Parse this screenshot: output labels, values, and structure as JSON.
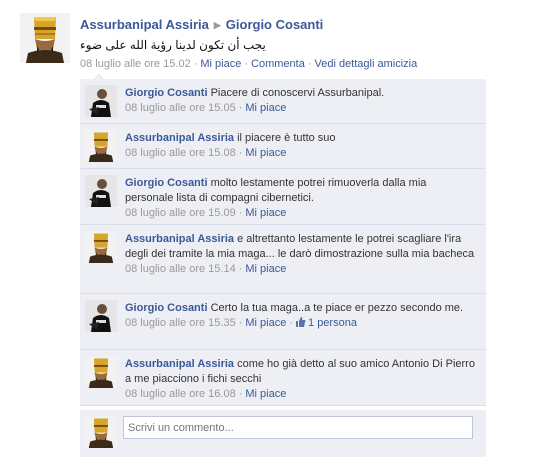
{
  "post": {
    "author": "Assurbanipal Assiria",
    "target": "Giorgio Cosanti",
    "text": "يجب أن تكون لدينا رؤية الله على ضوء",
    "time": "08 luglio alle ore 15.02",
    "like_label": "Mi piace",
    "comment_label": "Commenta",
    "friendship_label": "Vedi dettagli amicizia"
  },
  "like_label": "Mi piace",
  "comments": [
    {
      "author": "Giorgio Cosanti",
      "text": "Piacere di conoscervi Assurbanipal.",
      "time": "08 luglio alle ore 15.05"
    },
    {
      "author": "Assurbanipal Assiria",
      "text": "il piacere è tutto suo",
      "time": "08 luglio alle ore 15.08"
    },
    {
      "author": "Giorgio Cosanti",
      "text": "molto lestamente potrei rimuoverla dalla mia personale lista di compagni cibernetici.",
      "time": "08 luglio alle ore 15.09"
    },
    {
      "author": "Assurbanipal Assiria",
      "text": "e altrettanto lestamente le potrei scagliare l'ira degli dei tramite la mia maga... le darò dimostrazione sulla mia bacheca",
      "time": "08 luglio alle ore 15.14"
    },
    {
      "author": "Giorgio Cosanti",
      "text": "Certo la tua maga..a te piace er pezzo secondo me.",
      "time": "08 luglio alle ore 15.35",
      "likes": "1 persona"
    },
    {
      "author": "Assurbanipal Assiria",
      "text": "come ho già detto al suo amico Antonio Di Pierro a me piacciono i fichi secchi",
      "time": "08 luglio alle ore 16.08"
    }
  ],
  "composer": {
    "placeholder": "Scrivi un commento..."
  },
  "icons": {
    "pharaoh": "pharaoh-avatar",
    "person": "person-avatar",
    "like": "thumbs-up-icon"
  },
  "colors": {
    "link": "#3b5998",
    "bubble": "#edeff4",
    "meta": "#999999"
  }
}
